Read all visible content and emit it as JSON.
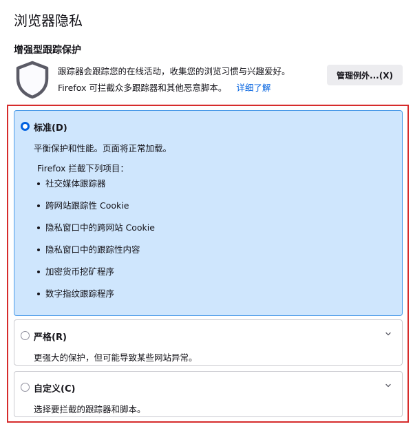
{
  "page": {
    "title": "浏览器隐私"
  },
  "etp": {
    "section_title": "增强型跟踪保护",
    "description_line1": "跟踪器会跟踪您的在线活动，收集您的浏览习惯与兴趣爱好。",
    "description_line2": "Firefox 可拦截众多跟踪器和其他恶意脚本。",
    "learn_more": "详细了解",
    "manage_exceptions_button": "管理例外...(X)",
    "icon": "shield-icon"
  },
  "options": {
    "standard": {
      "label": "标准(D)",
      "description": "平衡保护和性能。页面将正常加载。",
      "selected": true,
      "blocks_heading": "Firefox 拦截下列项目：",
      "blocks": [
        "社交媒体跟踪器",
        "跨网站跟踪性 Cookie",
        "隐私窗口中的跨网站 Cookie",
        "隐私窗口中的跟踪性内容",
        "加密货币挖矿程序",
        "数字指纹跟踪程序"
      ]
    },
    "strict": {
      "label": "严格(R)",
      "description": "更强大的保护，但可能导致某些网站异常。",
      "selected": false
    },
    "custom": {
      "label": "自定义(C)",
      "description": "选择要拦截的跟踪器和脚本。",
      "selected": false
    }
  },
  "colors": {
    "accent": "#0061e0",
    "selected_bg": "#cfe6fd",
    "highlight_outline": "#d62b2b"
  }
}
